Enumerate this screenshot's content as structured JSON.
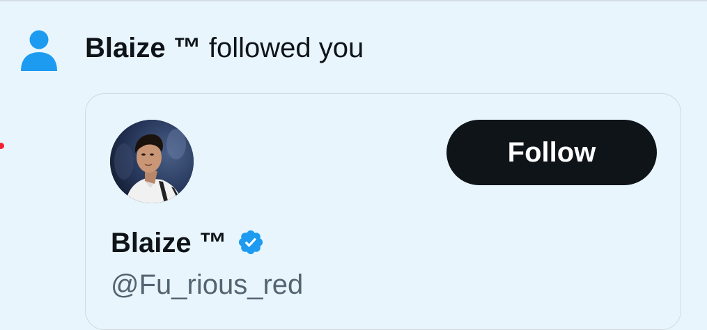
{
  "notification": {
    "actor_name": "Blaize ™",
    "action_text": " followed you",
    "icon": "person-icon"
  },
  "user_card": {
    "display_name": "Blaize ™",
    "handle": "@Fu_rious_red",
    "verified": true,
    "verified_icon": "verified-badge-icon",
    "follow_label": "Follow"
  },
  "colors": {
    "background": "#e8f5fd",
    "accent_blue": "#1d9bf0",
    "text_primary": "#0f1419",
    "text_secondary": "#536471",
    "button_bg": "#0f1419",
    "button_text": "#ffffff",
    "unread_dot": "#f4212e"
  }
}
